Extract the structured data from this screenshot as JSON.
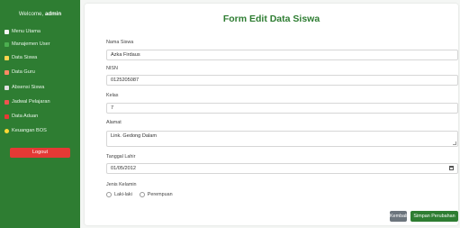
{
  "sidebar": {
    "welcome_prefix": "Welcome,",
    "welcome_user": "admin",
    "items": [
      {
        "label": "Menu Utama",
        "icon": "house-icon",
        "color": "#f5f5f5"
      },
      {
        "label": "Manajemen User",
        "icon": "users-icon",
        "color": "#4caf50"
      },
      {
        "label": "Data Siswa",
        "icon": "student-icon",
        "color": "#ffd54f"
      },
      {
        "label": "Data Guru",
        "icon": "teacher-icon",
        "color": "#ff8a65"
      },
      {
        "label": "Absensi Siswa",
        "icon": "clipboard-icon",
        "color": "#e0e0e0"
      },
      {
        "label": "Jadwal Pelajaran",
        "icon": "calendar-icon",
        "color": "#ef5350"
      },
      {
        "label": "Data Aduan",
        "icon": "inbox-icon",
        "color": "#e53935"
      },
      {
        "label": "Keuangan BOS",
        "icon": "money-icon",
        "color": "#fdd835"
      }
    ],
    "logout_label": "Logout"
  },
  "form": {
    "title": "Form Edit Data Siswa",
    "nama_label": "Nama Siswa",
    "nama_value": "Azka Firdaus",
    "nisn_label": "NISN",
    "nisn_value": "0125205087",
    "kelas_label": "Kelas",
    "kelas_value": "7",
    "alamat_label": "Alamat",
    "alamat_value": "Link. Gedong Dalam",
    "tgl_label": "Tanggal Lahir",
    "tgl_value": "01/05/2012",
    "jk_label": "Jenis Kelamin",
    "jk_options": [
      "Laki-laki",
      "Perempuan"
    ],
    "back_label": "Kembali",
    "save_label": "Simpan Perubahan"
  },
  "colors": {
    "sidebar": "#2e7d32",
    "accent": "#2e7d32",
    "logout": "#e53935",
    "back": "#6c757d"
  }
}
